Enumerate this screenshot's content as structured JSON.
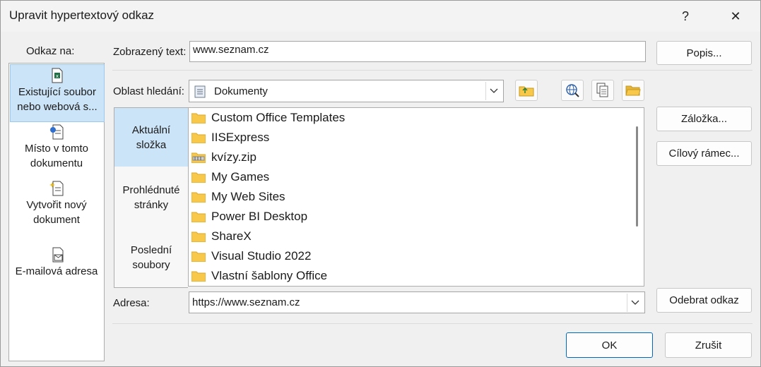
{
  "dialog": {
    "title": "Upravit hypertextový odkaz",
    "help_glyph": "?",
    "close_glyph": "✕"
  },
  "left_nav": {
    "header": "Odkaz na:",
    "items": [
      {
        "line1": "Existující soubor",
        "line2": "nebo webová s...",
        "icon": "existing-file-icon"
      },
      {
        "line1": "Místo v tomto",
        "line2": "dokumentu",
        "icon": "place-in-document-icon"
      },
      {
        "line1": "Vytvořit nový",
        "line2": "dokument",
        "icon": "new-document-icon"
      },
      {
        "line1": "E-mailová adresa",
        "line2": "",
        "icon": "email-icon"
      }
    ]
  },
  "display_text": {
    "label": "Zobrazený text:",
    "value": "www.seznam.cz",
    "button": "Popis..."
  },
  "look_in": {
    "label": "Oblast hledání:",
    "value": "Dokumenty",
    "icons": [
      "up-folder-icon",
      "browse-web-icon",
      "browse-file-icon",
      "open-folder-icon"
    ]
  },
  "side": {
    "items": [
      {
        "line1": "Aktuální",
        "line2": "složka"
      },
      {
        "line1": "Prohlédnuté",
        "line2": "stránky"
      },
      {
        "line1": "Poslední",
        "line2": "soubory"
      }
    ]
  },
  "files": [
    {
      "name": "Custom Office Templates",
      "icon": "folder-icon"
    },
    {
      "name": "IISExpress",
      "icon": "folder-icon"
    },
    {
      "name": "kvízy.zip",
      "icon": "zip-icon"
    },
    {
      "name": "My Games",
      "icon": "folder-icon"
    },
    {
      "name": "My Web Sites",
      "icon": "folder-icon"
    },
    {
      "name": "Power BI Desktop",
      "icon": "folder-icon"
    },
    {
      "name": "ShareX",
      "icon": "folder-icon"
    },
    {
      "name": "Visual Studio 2022",
      "icon": "folder-icon"
    },
    {
      "name": "Vlastní šablony Office",
      "icon": "folder-icon"
    }
  ],
  "right_buttons": {
    "bookmark": "Záložka...",
    "target_frame": "Cílový rámec...",
    "remove_link": "Odebrat odkaz"
  },
  "address": {
    "label": "Adresa:",
    "value": "https://www.seznam.cz"
  },
  "footer": {
    "ok": "OK",
    "cancel": "Zrušit"
  },
  "colors": {
    "selection": "#cce4f7",
    "folder": "#f7c84a",
    "primary_border": "#0067c0"
  }
}
